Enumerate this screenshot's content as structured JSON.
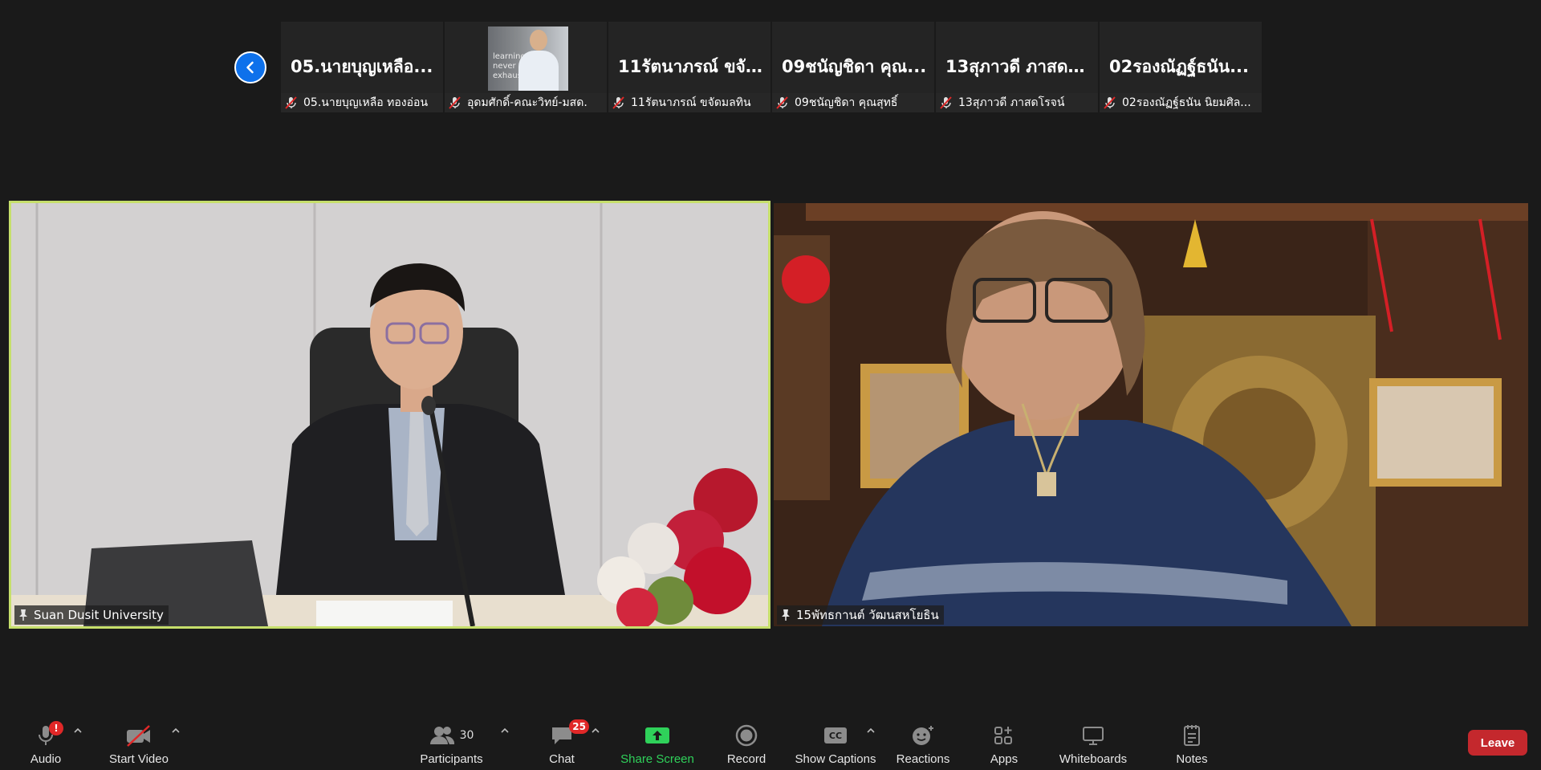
{
  "thumbnails": [
    {
      "title": "05.นายบุญเหลือ...",
      "name": "05.นายบุญเหลือ ทองอ่อน"
    },
    {
      "title": "",
      "name": "อุดมศักดิ์-คณะวิทย์-มสด.",
      "video_text": "learning\nnever\nexhaus"
    },
    {
      "title": "11รัตนาภรณ์ ขจั...",
      "name": "11รัตนาภรณ์ ขจัดมลทิน"
    },
    {
      "title": "09ชนัญชิดา คุณ...",
      "name": "09ชนัญชิดา คุณสุทธิ์"
    },
    {
      "title": "13สุภาวดี ภาสดโ...",
      "name": "13สุภาวดี ภาสดโรจน์"
    },
    {
      "title": "02รองณัฏฐ์ธนัน...",
      "name": "02รองณัฏฐ์ธนัน นิยมศิล..."
    }
  ],
  "main_tiles": {
    "left_name": "Suan Dusit University",
    "right_name": "15พัทธกานต์ วัฒนสหโยธิน"
  },
  "toolbar": {
    "audio": {
      "label": "Audio",
      "badge": "!"
    },
    "video": {
      "label": "Start Video"
    },
    "participants": {
      "label": "Participants",
      "count": "30"
    },
    "chat": {
      "label": "Chat",
      "badge": "25"
    },
    "share": {
      "label": "Share Screen"
    },
    "record": {
      "label": "Record"
    },
    "captions": {
      "label": "Show Captions",
      "icon_text": "CC"
    },
    "reactions": {
      "label": "Reactions"
    },
    "apps": {
      "label": "Apps"
    },
    "whiteboards": {
      "label": "Whiteboards"
    },
    "notes": {
      "label": "Notes"
    },
    "leave": {
      "label": "Leave"
    }
  },
  "colors": {
    "active_speaker_border": "#c6df6b",
    "leave": "#c4282d",
    "share_green": "#2fd15a",
    "badge_red": "#e02828",
    "nav_blue": "#0e71eb"
  }
}
